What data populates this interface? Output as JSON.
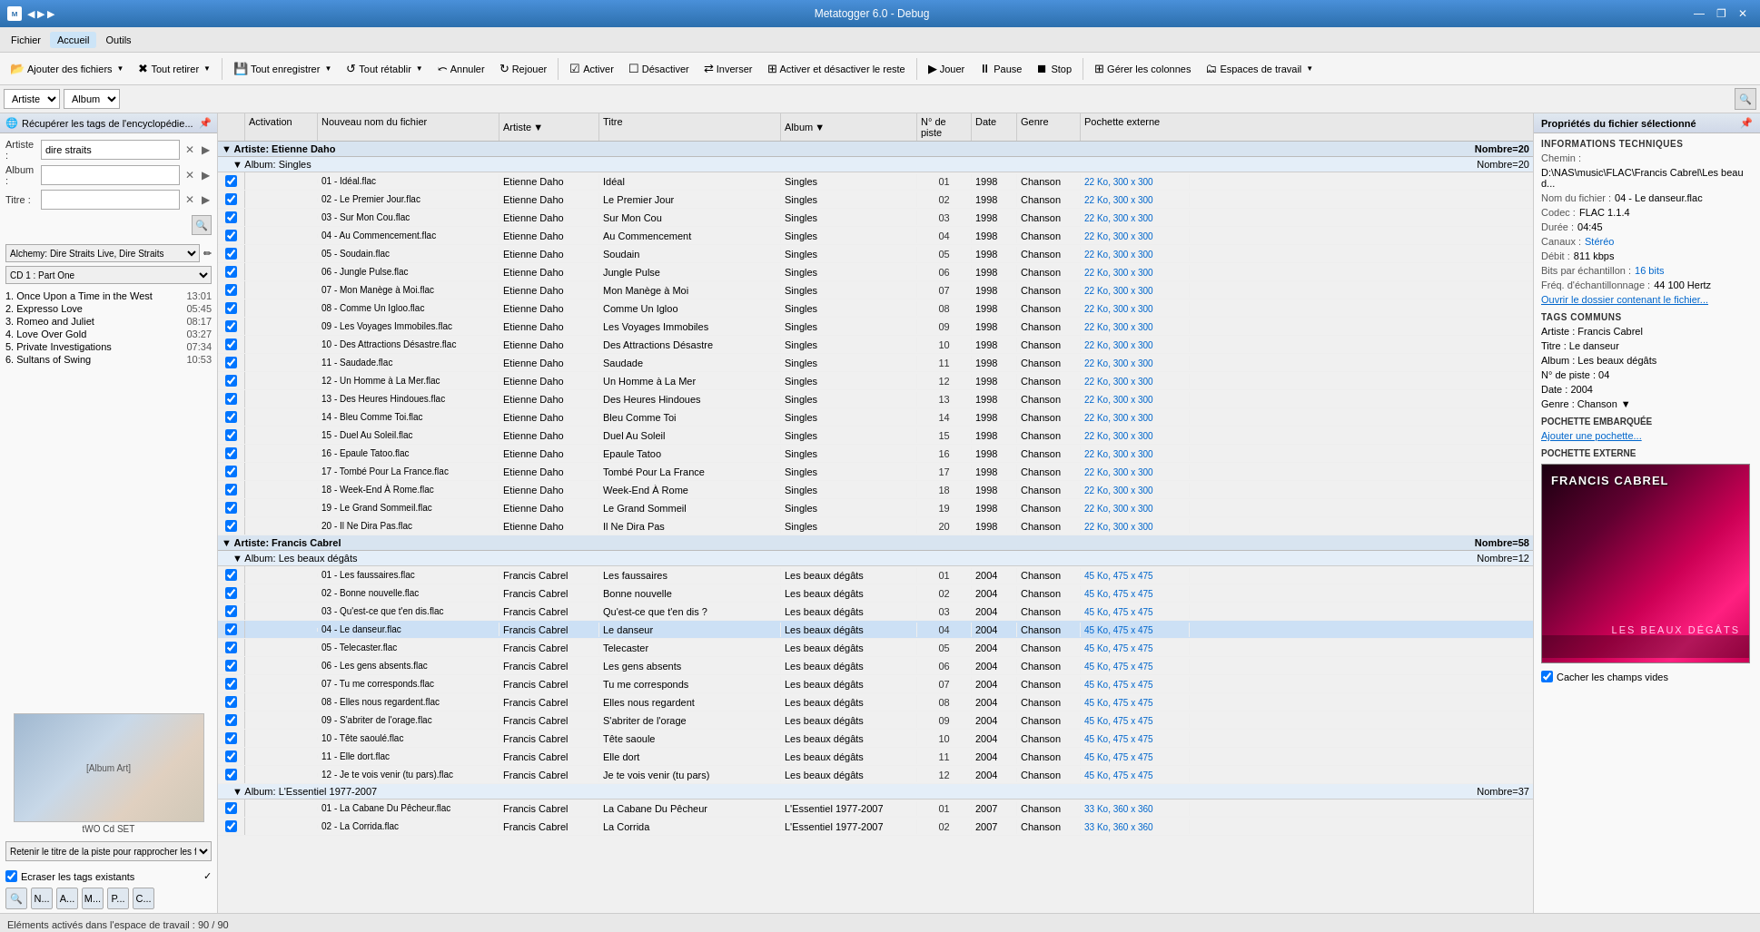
{
  "window": {
    "title": "Metatogger 6.0 - Debug",
    "min": "—",
    "max": "❐",
    "close": "✕"
  },
  "menu": {
    "items": [
      {
        "id": "fichier",
        "label": "Fichier"
      },
      {
        "id": "accueil",
        "label": "Accueil",
        "active": true
      },
      {
        "id": "outils",
        "label": "Outils"
      }
    ]
  },
  "toolbar": {
    "add_files": "Ajouter des fichiers",
    "remove_all": "Tout retirer",
    "save_all": "Tout enregistrer",
    "reset_all": "Tout rétablir",
    "cancel": "Annuler",
    "replay": "Rejouer",
    "activate": "Activer",
    "deactivate": "Désactiver",
    "invert": "Inverser",
    "toggle_rest": "Activer et désactiver le reste",
    "play": "Jouer",
    "pause": "Pause",
    "stop": "Stop",
    "manage_cols": "Gérer les colonnes",
    "workspaces": "Espaces de travail"
  },
  "left_panel": {
    "header": "Récupérer les tags de l'encyclopédie...",
    "artist_label": "Artiste :",
    "artist_value": "dire straits",
    "album_label": "Album :",
    "album_value": "",
    "title_label": "Titre :",
    "title_value": "",
    "alchemy_label": "Alchemy: Dire Straits Live, Dire Straits",
    "cd_option": "CD 1 : Part One",
    "tracks": [
      {
        "num": 1,
        "name": "Once Upon a Time in the West",
        "duration": "13:01"
      },
      {
        "num": 2,
        "name": "Expresso Love",
        "duration": "05:45"
      },
      {
        "num": 3,
        "name": "Romeo and Juliet",
        "duration": "08:17"
      },
      {
        "num": 4,
        "name": "Love Over Gold",
        "duration": "03:27"
      },
      {
        "num": 5,
        "name": "Private Investigations",
        "duration": "07:34"
      },
      {
        "num": 6,
        "name": "Sultans of Swing",
        "duration": "10:53"
      }
    ],
    "album_art_caption": "tWO Cd SET",
    "retenir_label": "Retenir le titre de la piste pour rapprocher les fic...",
    "ecraser_label": "Ecraser les tags existants",
    "tool_icons": [
      "🔍",
      "N...",
      "A...",
      "M...",
      "P...",
      "C..."
    ]
  },
  "search_bar": {
    "artist_select": "Artiste",
    "album_select": "Album"
  },
  "table": {
    "headers": {
      "activation": "Activation",
      "new_filename": "Nouveau nom du fichier",
      "artist": "Artiste",
      "title": "Titre",
      "album": "Album",
      "track_num": "N° de piste",
      "date": "Date",
      "genre": "Genre",
      "cover": "Pochette externe"
    },
    "groups": [
      {
        "type": "artist",
        "label": "Artiste: Etienne Daho",
        "count": "Nombre=20",
        "subgroups": [
          {
            "label": "Album: Singles",
            "count": "Nombre=20",
            "rows": [
              {
                "filename": "01 - Idéal.flac",
                "artist": "Etienne Daho",
                "title": "Idéal",
                "album": "Singles",
                "track": "01",
                "date": "1998",
                "genre": "Chanson",
                "cover": "22 Ko, 300 x 300"
              },
              {
                "filename": "02 - Le Premier Jour.flac",
                "artist": "Etienne Daho",
                "title": "Le Premier Jour",
                "album": "Singles",
                "track": "02",
                "date": "1998",
                "genre": "Chanson",
                "cover": "22 Ko, 300 x 300"
              },
              {
                "filename": "03 - Sur Mon Cou.flac",
                "artist": "Etienne Daho",
                "title": "Sur Mon Cou",
                "album": "Singles",
                "track": "03",
                "date": "1998",
                "genre": "Chanson",
                "cover": "22 Ko, 300 x 300"
              },
              {
                "filename": "04 - Au Commencement.flac",
                "artist": "Etienne Daho",
                "title": "Au Commencement",
                "album": "Singles",
                "track": "04",
                "date": "1998",
                "genre": "Chanson",
                "cover": "22 Ko, 300 x 300"
              },
              {
                "filename": "05 - Soudain.flac",
                "artist": "Etienne Daho",
                "title": "Soudain",
                "album": "Singles",
                "track": "05",
                "date": "1998",
                "genre": "Chanson",
                "cover": "22 Ko, 300 x 300"
              },
              {
                "filename": "06 - Jungle Pulse.flac",
                "artist": "Etienne Daho",
                "title": "Jungle Pulse",
                "album": "Singles",
                "track": "06",
                "date": "1998",
                "genre": "Chanson",
                "cover": "22 Ko, 300 x 300"
              },
              {
                "filename": "07 - Mon Manège à Moi.flac",
                "artist": "Etienne Daho",
                "title": "Mon Manège à Moi",
                "album": "Singles",
                "track": "07",
                "date": "1998",
                "genre": "Chanson",
                "cover": "22 Ko, 300 x 300"
              },
              {
                "filename": "08 - Comme Un Igloo.flac",
                "artist": "Etienne Daho",
                "title": "Comme Un Igloo",
                "album": "Singles",
                "track": "08",
                "date": "1998",
                "genre": "Chanson",
                "cover": "22 Ko, 300 x 300"
              },
              {
                "filename": "09 - Les Voyages Immobiles.flac",
                "artist": "Etienne Daho",
                "title": "Les Voyages Immobiles",
                "album": "Singles",
                "track": "09",
                "date": "1998",
                "genre": "Chanson",
                "cover": "22 Ko, 300 x 300"
              },
              {
                "filename": "10 - Des Attractions Désastre.flac",
                "artist": "Etienne Daho",
                "title": "Des Attractions Désastre",
                "album": "Singles",
                "track": "10",
                "date": "1998",
                "genre": "Chanson",
                "cover": "22 Ko, 300 x 300"
              },
              {
                "filename": "11 - Saudade.flac",
                "artist": "Etienne Daho",
                "title": "Saudade",
                "album": "Singles",
                "track": "11",
                "date": "1998",
                "genre": "Chanson",
                "cover": "22 Ko, 300 x 300"
              },
              {
                "filename": "12 - Un Homme à La Mer.flac",
                "artist": "Etienne Daho",
                "title": "Un Homme à La Mer",
                "album": "Singles",
                "track": "12",
                "date": "1998",
                "genre": "Chanson",
                "cover": "22 Ko, 300 x 300"
              },
              {
                "filename": "13 - Des Heures Hindoues.flac",
                "artist": "Etienne Daho",
                "title": "Des Heures Hindoues",
                "album": "Singles",
                "track": "13",
                "date": "1998",
                "genre": "Chanson",
                "cover": "22 Ko, 300 x 300"
              },
              {
                "filename": "14 - Bleu Comme Toi.flac",
                "artist": "Etienne Daho",
                "title": "Bleu Comme Toi",
                "album": "Singles",
                "track": "14",
                "date": "1998",
                "genre": "Chanson",
                "cover": "22 Ko, 300 x 300"
              },
              {
                "filename": "15 - Duel Au Soleil.flac",
                "artist": "Etienne Daho",
                "title": "Duel Au Soleil",
                "album": "Singles",
                "track": "15",
                "date": "1998",
                "genre": "Chanson",
                "cover": "22 Ko, 300 x 300"
              },
              {
                "filename": "16 - Epaule Tatoo.flac",
                "artist": "Etienne Daho",
                "title": "Epaule Tatoo",
                "album": "Singles",
                "track": "16",
                "date": "1998",
                "genre": "Chanson",
                "cover": "22 Ko, 300 x 300"
              },
              {
                "filename": "17 - Tombé Pour La France.flac",
                "artist": "Etienne Daho",
                "title": "Tombé Pour La France",
                "album": "Singles",
                "track": "17",
                "date": "1998",
                "genre": "Chanson",
                "cover": "22 Ko, 300 x 300"
              },
              {
                "filename": "18 - Week-End À Rome.flac",
                "artist": "Etienne Daho",
                "title": "Week-End À Rome",
                "album": "Singles",
                "track": "18",
                "date": "1998",
                "genre": "Chanson",
                "cover": "22 Ko, 300 x 300"
              },
              {
                "filename": "19 - Le Grand Sommeil.flac",
                "artist": "Etienne Daho",
                "title": "Le Grand Sommeil",
                "album": "Singles",
                "track": "19",
                "date": "1998",
                "genre": "Chanson",
                "cover": "22 Ko, 300 x 300"
              },
              {
                "filename": "20 - Il Ne Dira Pas.flac",
                "artist": "Etienne Daho",
                "title": "Il Ne Dira Pas",
                "album": "Singles",
                "track": "20",
                "date": "1998",
                "genre": "Chanson",
                "cover": "22 Ko, 300 x 300"
              }
            ]
          }
        ]
      },
      {
        "type": "artist",
        "label": "Artiste: Francis Cabrel",
        "count": "Nombre=58",
        "subgroups": [
          {
            "label": "Album: Les beaux dégâts",
            "count": "Nombre=12",
            "rows": [
              {
                "filename": "01 - Les faussaires.flac",
                "artist": "Francis Cabrel",
                "title": "Les faussaires",
                "album": "Les beaux dégâts",
                "track": "01",
                "date": "2004",
                "genre": "Chanson",
                "cover": "45 Ko, 475 x 475",
                "selected": false
              },
              {
                "filename": "02 - Bonne nouvelle.flac",
                "artist": "Francis Cabrel",
                "title": "Bonne nouvelle",
                "album": "Les beaux dégâts",
                "track": "02",
                "date": "2004",
                "genre": "Chanson",
                "cover": "45 Ko, 475 x 475"
              },
              {
                "filename": "03 - Qu'est-ce que t'en dis.flac",
                "artist": "Francis Cabrel",
                "title": "Qu'est-ce que t'en dis ?",
                "album": "Les beaux dégâts",
                "track": "03",
                "date": "2004",
                "genre": "Chanson",
                "cover": "45 Ko, 475 x 475"
              },
              {
                "filename": "04 - Le danseur.flac",
                "artist": "Francis Cabrel",
                "title": "Le danseur",
                "album": "Les beaux dégâts",
                "track": "04",
                "date": "2004",
                "genre": "Chanson",
                "cover": "45 Ko, 475 x 475",
                "selected": true
              },
              {
                "filename": "05 - Telecaster.flac",
                "artist": "Francis Cabrel",
                "title": "Telecaster",
                "album": "Les beaux dégâts",
                "track": "05",
                "date": "2004",
                "genre": "Chanson",
                "cover": "45 Ko, 475 x 475"
              },
              {
                "filename": "06 - Les gens absents.flac",
                "artist": "Francis Cabrel",
                "title": "Les gens absents",
                "album": "Les beaux dégâts",
                "track": "06",
                "date": "2004",
                "genre": "Chanson",
                "cover": "45 Ko, 475 x 475"
              },
              {
                "filename": "07 - Tu me corresponds.flac",
                "artist": "Francis Cabrel",
                "title": "Tu me corresponds",
                "album": "Les beaux dégâts",
                "track": "07",
                "date": "2004",
                "genre": "Chanson",
                "cover": "45 Ko, 475 x 475"
              },
              {
                "filename": "08 - Elles nous regardent.flac",
                "artist": "Francis Cabrel",
                "title": "Elles nous regardent",
                "album": "Les beaux dégâts",
                "track": "08",
                "date": "2004",
                "genre": "Chanson",
                "cover": "45 Ko, 475 x 475"
              },
              {
                "filename": "09 - S'abriter de l'orage.flac",
                "artist": "Francis Cabrel",
                "title": "S'abriter de l'orage",
                "album": "Les beaux dégâts",
                "track": "09",
                "date": "2004",
                "genre": "Chanson",
                "cover": "45 Ko, 475 x 475"
              },
              {
                "filename": "10 - Tête saoulé.flac",
                "artist": "Francis Cabrel",
                "title": "Tête saoule",
                "album": "Les beaux dégâts",
                "track": "10",
                "date": "2004",
                "genre": "Chanson",
                "cover": "45 Ko, 475 x 475"
              },
              {
                "filename": "11 - Elle dort.flac",
                "artist": "Francis Cabrel",
                "title": "Elle dort",
                "album": "Les beaux dégâts",
                "track": "11",
                "date": "2004",
                "genre": "Chanson",
                "cover": "45 Ko, 475 x 475"
              },
              {
                "filename": "12 - Je te vois venir (tu pars).flac",
                "artist": "Francis Cabrel",
                "title": "Je te vois venir (tu pars)",
                "album": "Les beaux dégâts",
                "track": "12",
                "date": "2004",
                "genre": "Chanson",
                "cover": "45 Ko, 475 x 475"
              }
            ]
          },
          {
            "label": "Album: L'Essentiel 1977-2007",
            "count": "Nombre=37",
            "rows": [
              {
                "filename": "01 - La Cabane Du Pêcheur.flac",
                "artist": "Francis Cabrel",
                "title": "La Cabane Du Pêcheur",
                "album": "L'Essentiel 1977-2007",
                "track": "01",
                "date": "2007",
                "genre": "Chanson",
                "cover": "33 Ko, 360 x 360"
              },
              {
                "filename": "02 - La Corrida.flac",
                "artist": "Francis Cabrel",
                "title": "La Corrida",
                "album": "L'Essentiel 1977-2007",
                "track": "02",
                "date": "2007",
                "genre": "Chanson",
                "cover": "33 Ko, 360 x 360"
              }
            ]
          }
        ]
      }
    ]
  },
  "right_panel": {
    "header": "Propriétés du fichier sélectionné",
    "tech_info_title": "INFORMATIONS TECHNIQUES",
    "path_label": "Chemin :",
    "path_value": "D:\\NAS\\music\\FLAC\\Francis Cabrel\\Les beau d...",
    "filename_label": "Nom du fichier :",
    "filename_value": "04 - Le danseur.flac",
    "codec_label": "Codec :",
    "codec_value": "FLAC 1.1.4",
    "duration_label": "Durée :",
    "duration_value": "04:45",
    "channels_label": "Canaux :",
    "channels_value": "Stéréo",
    "bitrate_label": "Débit :",
    "bitrate_value": "811 kbps",
    "bits_label": "Bits par échantillon :",
    "bits_value": "16 bits",
    "freq_label": "Fréq. d'échantillonnage :",
    "freq_value": "44 100 Hertz",
    "open_folder_link": "Ouvrir le dossier contenant le fichier...",
    "tags_title": "TAGS COMMUNS",
    "artist_tag": "Artiste : Francis Cabrel",
    "title_tag": "Titre : Le danseur",
    "album_tag": "Album : Les beaux dégâts",
    "track_tag": "N° de piste : 04",
    "date_tag": "Date : 2004",
    "genre_tag": "Genre : Chanson",
    "embedded_cover_title": "POCHETTE EMBARQUÉE",
    "add_cover_link": "Ajouter une pochette...",
    "external_cover_title": "POCHETTE EXTERNE",
    "hide_empty_label": "Cacher les champs vides"
  },
  "status_bar": {
    "text": "Eléments activés dans l'espace de travail : 90 / 90"
  }
}
